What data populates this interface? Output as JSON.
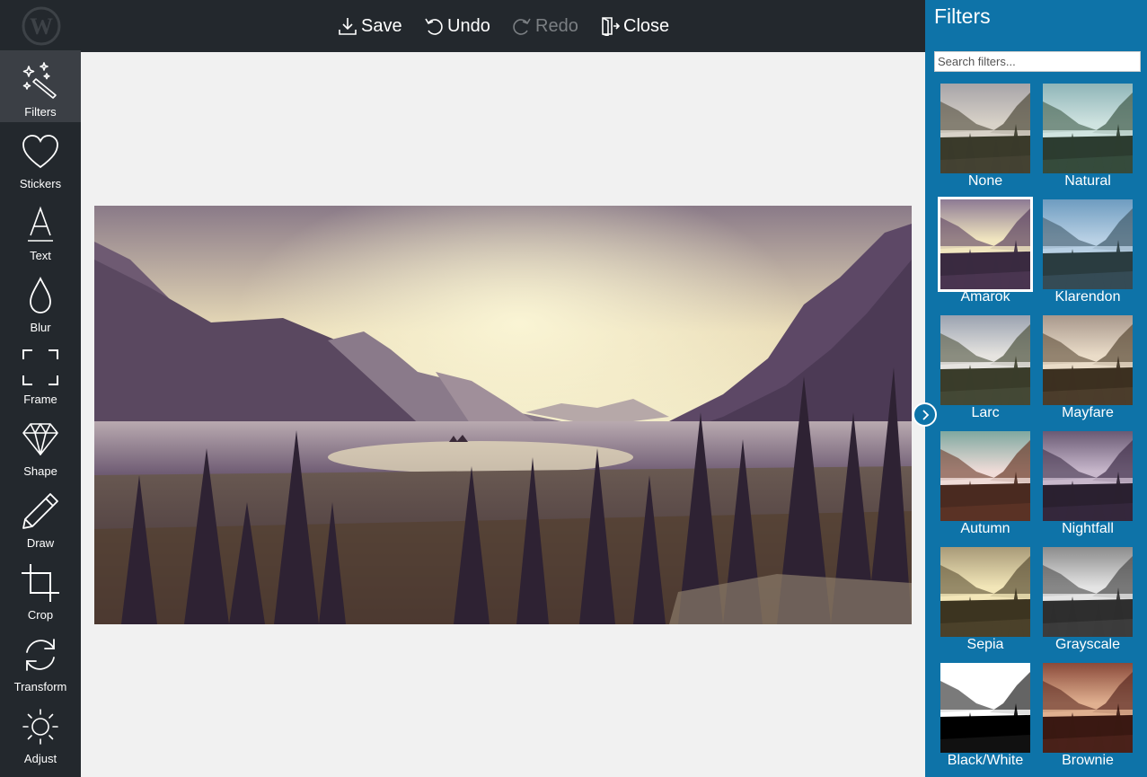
{
  "toolbar": {
    "save_label": "Save",
    "undo_label": "Undo",
    "redo_label": "Redo",
    "close_label": "Close"
  },
  "sidebar": {
    "items": [
      {
        "label": "Filters",
        "icon": "magic-wand-icon",
        "active": true
      },
      {
        "label": "Stickers",
        "icon": "heart-icon"
      },
      {
        "label": "Text",
        "icon": "text-icon"
      },
      {
        "label": "Blur",
        "icon": "drop-icon"
      },
      {
        "label": "Frame",
        "icon": "frame-icon"
      },
      {
        "label": "Shape",
        "icon": "diamond-icon"
      },
      {
        "label": "Draw",
        "icon": "pencil-icon"
      },
      {
        "label": "Crop",
        "icon": "crop-icon"
      },
      {
        "label": "Transform",
        "icon": "rotate-icon"
      },
      {
        "label": "Adjust",
        "icon": "sun-icon"
      }
    ]
  },
  "panel": {
    "title": "Filters",
    "search_placeholder": "Search filters...",
    "filters": [
      {
        "label": "None",
        "selected": false
      },
      {
        "label": "Natural",
        "selected": false
      },
      {
        "label": "Amarok",
        "selected": true
      },
      {
        "label": "Klarendon",
        "selected": false
      },
      {
        "label": "Larc",
        "selected": false
      },
      {
        "label": "Mayfare",
        "selected": false
      },
      {
        "label": "Autumn",
        "selected": false
      },
      {
        "label": "Nightfall",
        "selected": false
      },
      {
        "label": "Sepia",
        "selected": false
      },
      {
        "label": "Grayscale",
        "selected": false
      },
      {
        "label": "Black/White",
        "selected": false
      },
      {
        "label": "Brownie",
        "selected": false
      }
    ]
  },
  "colors": {
    "sidebar_bg": "#23282d",
    "panel_bg": "#0e73a8",
    "canvas_bg": "#f1f1f1"
  }
}
